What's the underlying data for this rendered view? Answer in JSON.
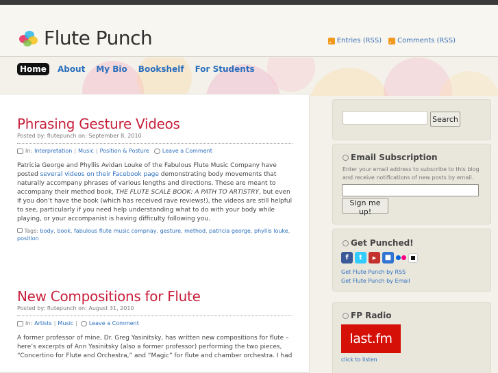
{
  "site": {
    "title": "Flute Punch",
    "feeds": [
      "Entries (RSS)",
      "Comments (RSS)"
    ]
  },
  "nav": {
    "items": [
      "Home",
      "About",
      "My Bio",
      "Bookshelf",
      "For Students"
    ],
    "active": "Home"
  },
  "posts": [
    {
      "title": "Phrasing Gesture Videos",
      "meta": "Posted by: flutepunch on: September 8, 2010",
      "in_label": "In:",
      "categories": [
        "Interpretation",
        "Music",
        "Position & Posture"
      ],
      "comment_label": "Leave a Comment",
      "body_before_link": "Patricia George and Phyllis Avidan Louke of the Fabulous Flute Music Company have posted ",
      "body_link": "several videos on their Facebook page",
      "body_mid": " demonstrating body movements that naturally accompany phrases of various lengths and directions. These are meant to accompany their method book, ",
      "body_em": "THE FLUTE SCALE BOOK: A PATH TO ARTISTRY",
      "body_after": ", but even if you don’t have the book (which has received rave reviews!), the videos are still helpful to see, particularly if you need help understanding what to do with your body while playing, or your accompanist is having difficulty following you.",
      "tags_label": "Tags:",
      "tags": [
        "body",
        "book",
        "fabulous flute music compnay",
        "gesture",
        "method",
        "patricia george",
        "phyllis louke",
        "position"
      ]
    },
    {
      "title": "New Compositions for Flute",
      "meta": "Posted by: flutepunch on: August 31, 2010",
      "in_label": "In:",
      "categories": [
        "Artists",
        "Music"
      ],
      "comment_label": "Leave a Comment",
      "body": "A former professor of mine, Dr. Greg Yasinitsky, has written new compositions for flute – here’s excerpts of Ann Yasinitsky (also a former professor) performing the two pieces, “Concertino for Flute and Orchestra,” and “Magic” for flute and chamber orchestra. I had"
    }
  ],
  "sidebar": {
    "search_button": "Search",
    "email": {
      "title": "Email Subscription",
      "description": "Enter your email address to subscribe to this blog and receive notifications of new posts by email.",
      "button": "Sign me up!"
    },
    "punched": {
      "title": "Get Punched!",
      "icons": [
        "facebook-icon",
        "twitter-icon",
        "youtube-icon",
        "delicious-icon",
        "flickr-icon",
        "stumble-icon"
      ],
      "links": [
        "Get Flute Punch by RSS",
        "Get Flute Punch by Email"
      ]
    },
    "radio": {
      "title": "FP Radio",
      "logo_text": "last.fm",
      "link": "click to listen"
    }
  },
  "colors": {
    "accent": "#c8203b",
    "link": "#2a6ebd",
    "lastfm": "#d51007"
  }
}
